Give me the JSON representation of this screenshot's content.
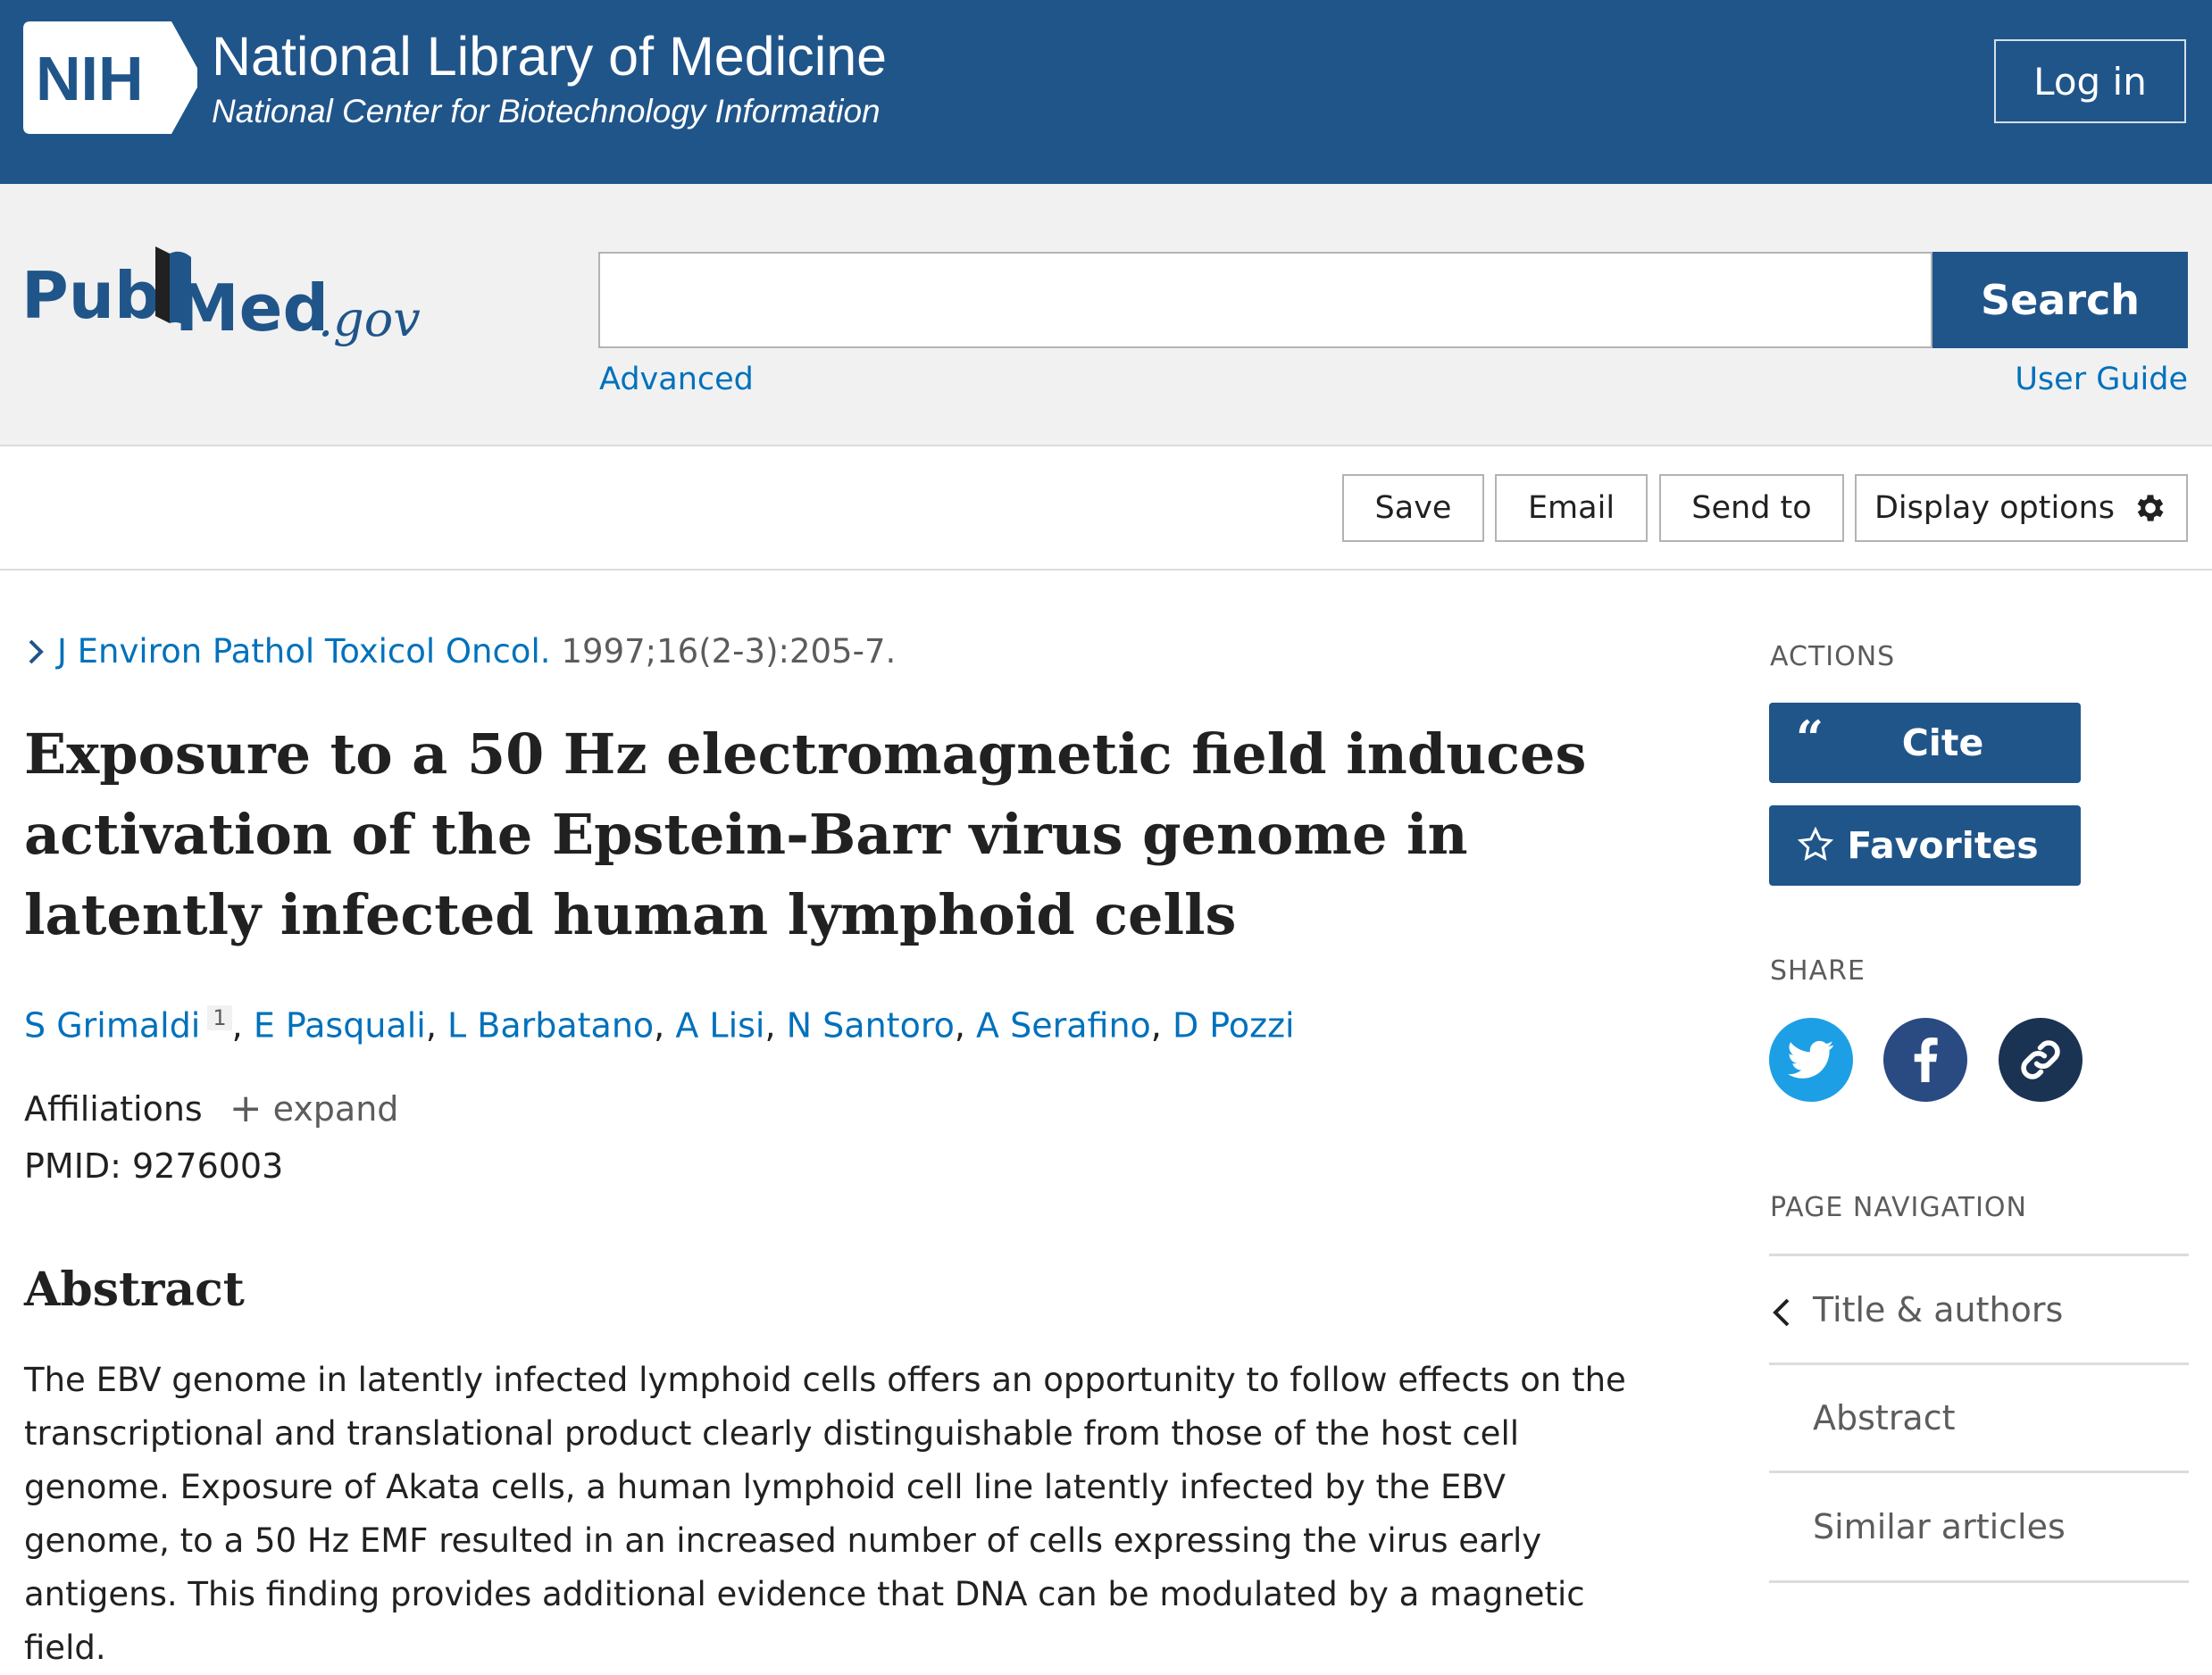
{
  "banner": {
    "logo_text": "NIH",
    "title": "National Library of Medicine",
    "subtitle": "National Center for Biotechnology Information",
    "login_label": "Log in",
    "bg_color": "#20558a"
  },
  "search": {
    "logo_alt": "PubMed.gov",
    "placeholder": "",
    "button_label": "Search",
    "advanced_label": "Advanced",
    "user_guide_label": "User Guide"
  },
  "toolbar": {
    "save_label": "Save",
    "email_label": "Email",
    "send_to_label": "Send to",
    "display_options_label": "Display options"
  },
  "article": {
    "journal": "J Environ Pathol Toxicol Oncol.",
    "citation": "1997;16(2-3):205-7.",
    "title": "Exposure to a 50 Hz electromagnetic field induces activation of the Epstein-Barr virus genome in latently infected human lymphoid cells",
    "authors": [
      "S Grimaldi",
      "E Pasquali",
      "L Barbatano",
      "A Lisi",
      "N Santoro",
      "A Serafino",
      "D Pozzi"
    ],
    "first_author_affiliation_ref": "1",
    "affiliations_label": "Affiliations",
    "expand_label": "expand",
    "pmid_text": "PMID: 9276003",
    "abstract_heading": "Abstract",
    "abstract_text": "The EBV genome in latently infected lymphoid cells offers an opportunity to follow effects on the transcriptional and translational product clearly distinguishable from those of the host cell genome. Exposure of Akata cells, a human lymphoid cell line latently infected by the EBV genome, to a 50 Hz EMF resulted in an increased number of cells expressing the virus early antigens. This finding provides additional evidence that DNA can be modulated by a magnetic field."
  },
  "sidebar": {
    "actions_heading": "ACTIONS",
    "cite_label": "Cite",
    "favorites_label": "Favorites",
    "share_heading": "SHARE",
    "share_icons": [
      "twitter-icon",
      "facebook-icon",
      "permalink-icon"
    ],
    "page_nav_heading": "PAGE NAVIGATION",
    "nav_items": [
      "Title & authors",
      "Abstract",
      "Similar articles"
    ]
  }
}
